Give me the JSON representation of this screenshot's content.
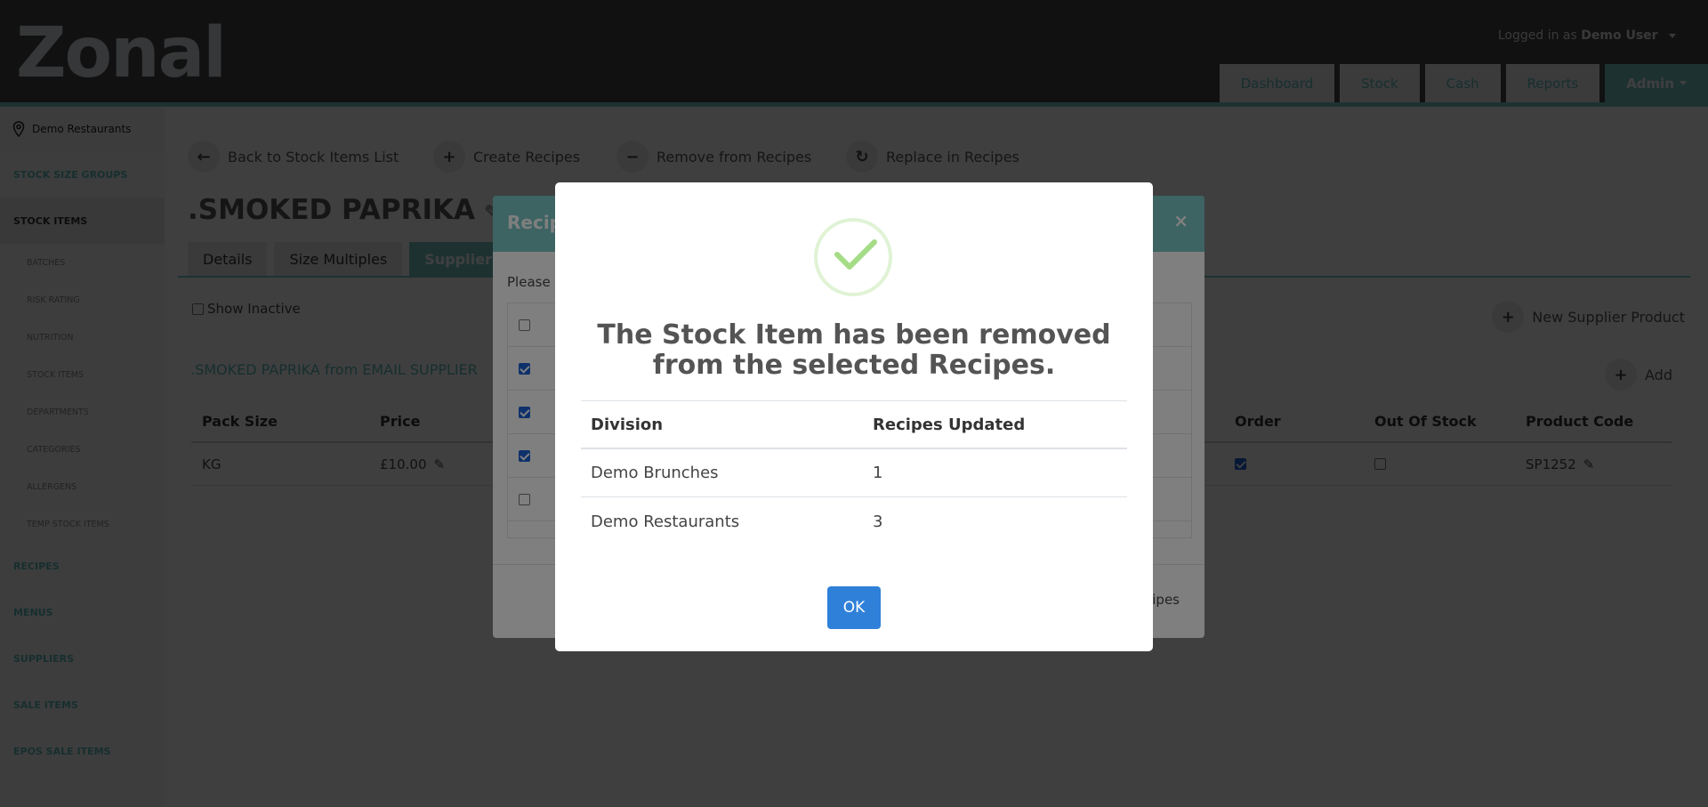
{
  "header": {
    "logo": "Zonal",
    "login_prefix": "Logged in as",
    "login_user": "Demo User",
    "nav": [
      "Dashboard",
      "Stock",
      "Cash",
      "Reports",
      "Admin"
    ]
  },
  "sidebar": {
    "location": "Demo Restaurants",
    "items": [
      {
        "label": "STOCK SIZE GROUPS",
        "type": "main"
      },
      {
        "label": "STOCK ITEMS",
        "type": "main",
        "active": true
      },
      {
        "label": "BATCHES",
        "type": "sub"
      },
      {
        "label": "RISK RATING",
        "type": "sub"
      },
      {
        "label": "NUTRITION",
        "type": "sub"
      },
      {
        "label": "STOCK ITEMS",
        "type": "sub"
      },
      {
        "label": "DEPARTMENTS",
        "type": "sub"
      },
      {
        "label": "CATEGORIES",
        "type": "sub"
      },
      {
        "label": "ALLERGENS",
        "type": "sub"
      },
      {
        "label": "TEMP STOCK ITEMS",
        "type": "sub"
      },
      {
        "label": "RECIPES",
        "type": "main"
      },
      {
        "label": "MENUS",
        "type": "main"
      },
      {
        "label": "SUPPLIERS",
        "type": "main"
      },
      {
        "label": "SALE ITEMS",
        "type": "main"
      },
      {
        "label": "EPOS SALE ITEMS",
        "type": "main"
      }
    ]
  },
  "actions": {
    "back": "Back to Stock Items List",
    "create": "Create Recipes",
    "remove": "Remove from Recipes",
    "replace": "Replace in Recipes"
  },
  "item": {
    "title": ".SMOKED PAPRIKA",
    "tabs": [
      "Details",
      "Size Multiples",
      "Supplier P"
    ],
    "show_inactive": "Show Inactive",
    "new_supplier_product": "New Supplier Product",
    "section_title": ".SMOKED PAPRIKA from EMAIL SUPPLIER",
    "add_label": "Add",
    "columns": {
      "pack_size": "Pack Size",
      "price": "Price",
      "order": "Order",
      "out_of_stock": "Out Of Stock",
      "product_code": "Product Code"
    },
    "row": {
      "pack_size": "KG",
      "price": "£10.00",
      "order_checked": true,
      "out_of_stock_checked": false,
      "product_code": "SP1252"
    }
  },
  "background_modal": {
    "title": "Recip",
    "please_text": "Please",
    "rows_checked": [
      false,
      true,
      true,
      true,
      false
    ],
    "footer_label": "ipes"
  },
  "dialog": {
    "title": "The Stock Item has been removed from the selected Recipes.",
    "table": {
      "headers": [
        "Division",
        "Recipes Updated"
      ],
      "rows": [
        {
          "division": "Demo Brunches",
          "recipes_updated": "1"
        },
        {
          "division": "Demo Restaurants",
          "recipes_updated": "3"
        }
      ]
    },
    "ok_label": "OK"
  },
  "colors": {
    "header_bg": "#454545",
    "teal": "#7bc6c6",
    "ok_button": "#2f80d9",
    "success_check": "#a5dc86"
  }
}
